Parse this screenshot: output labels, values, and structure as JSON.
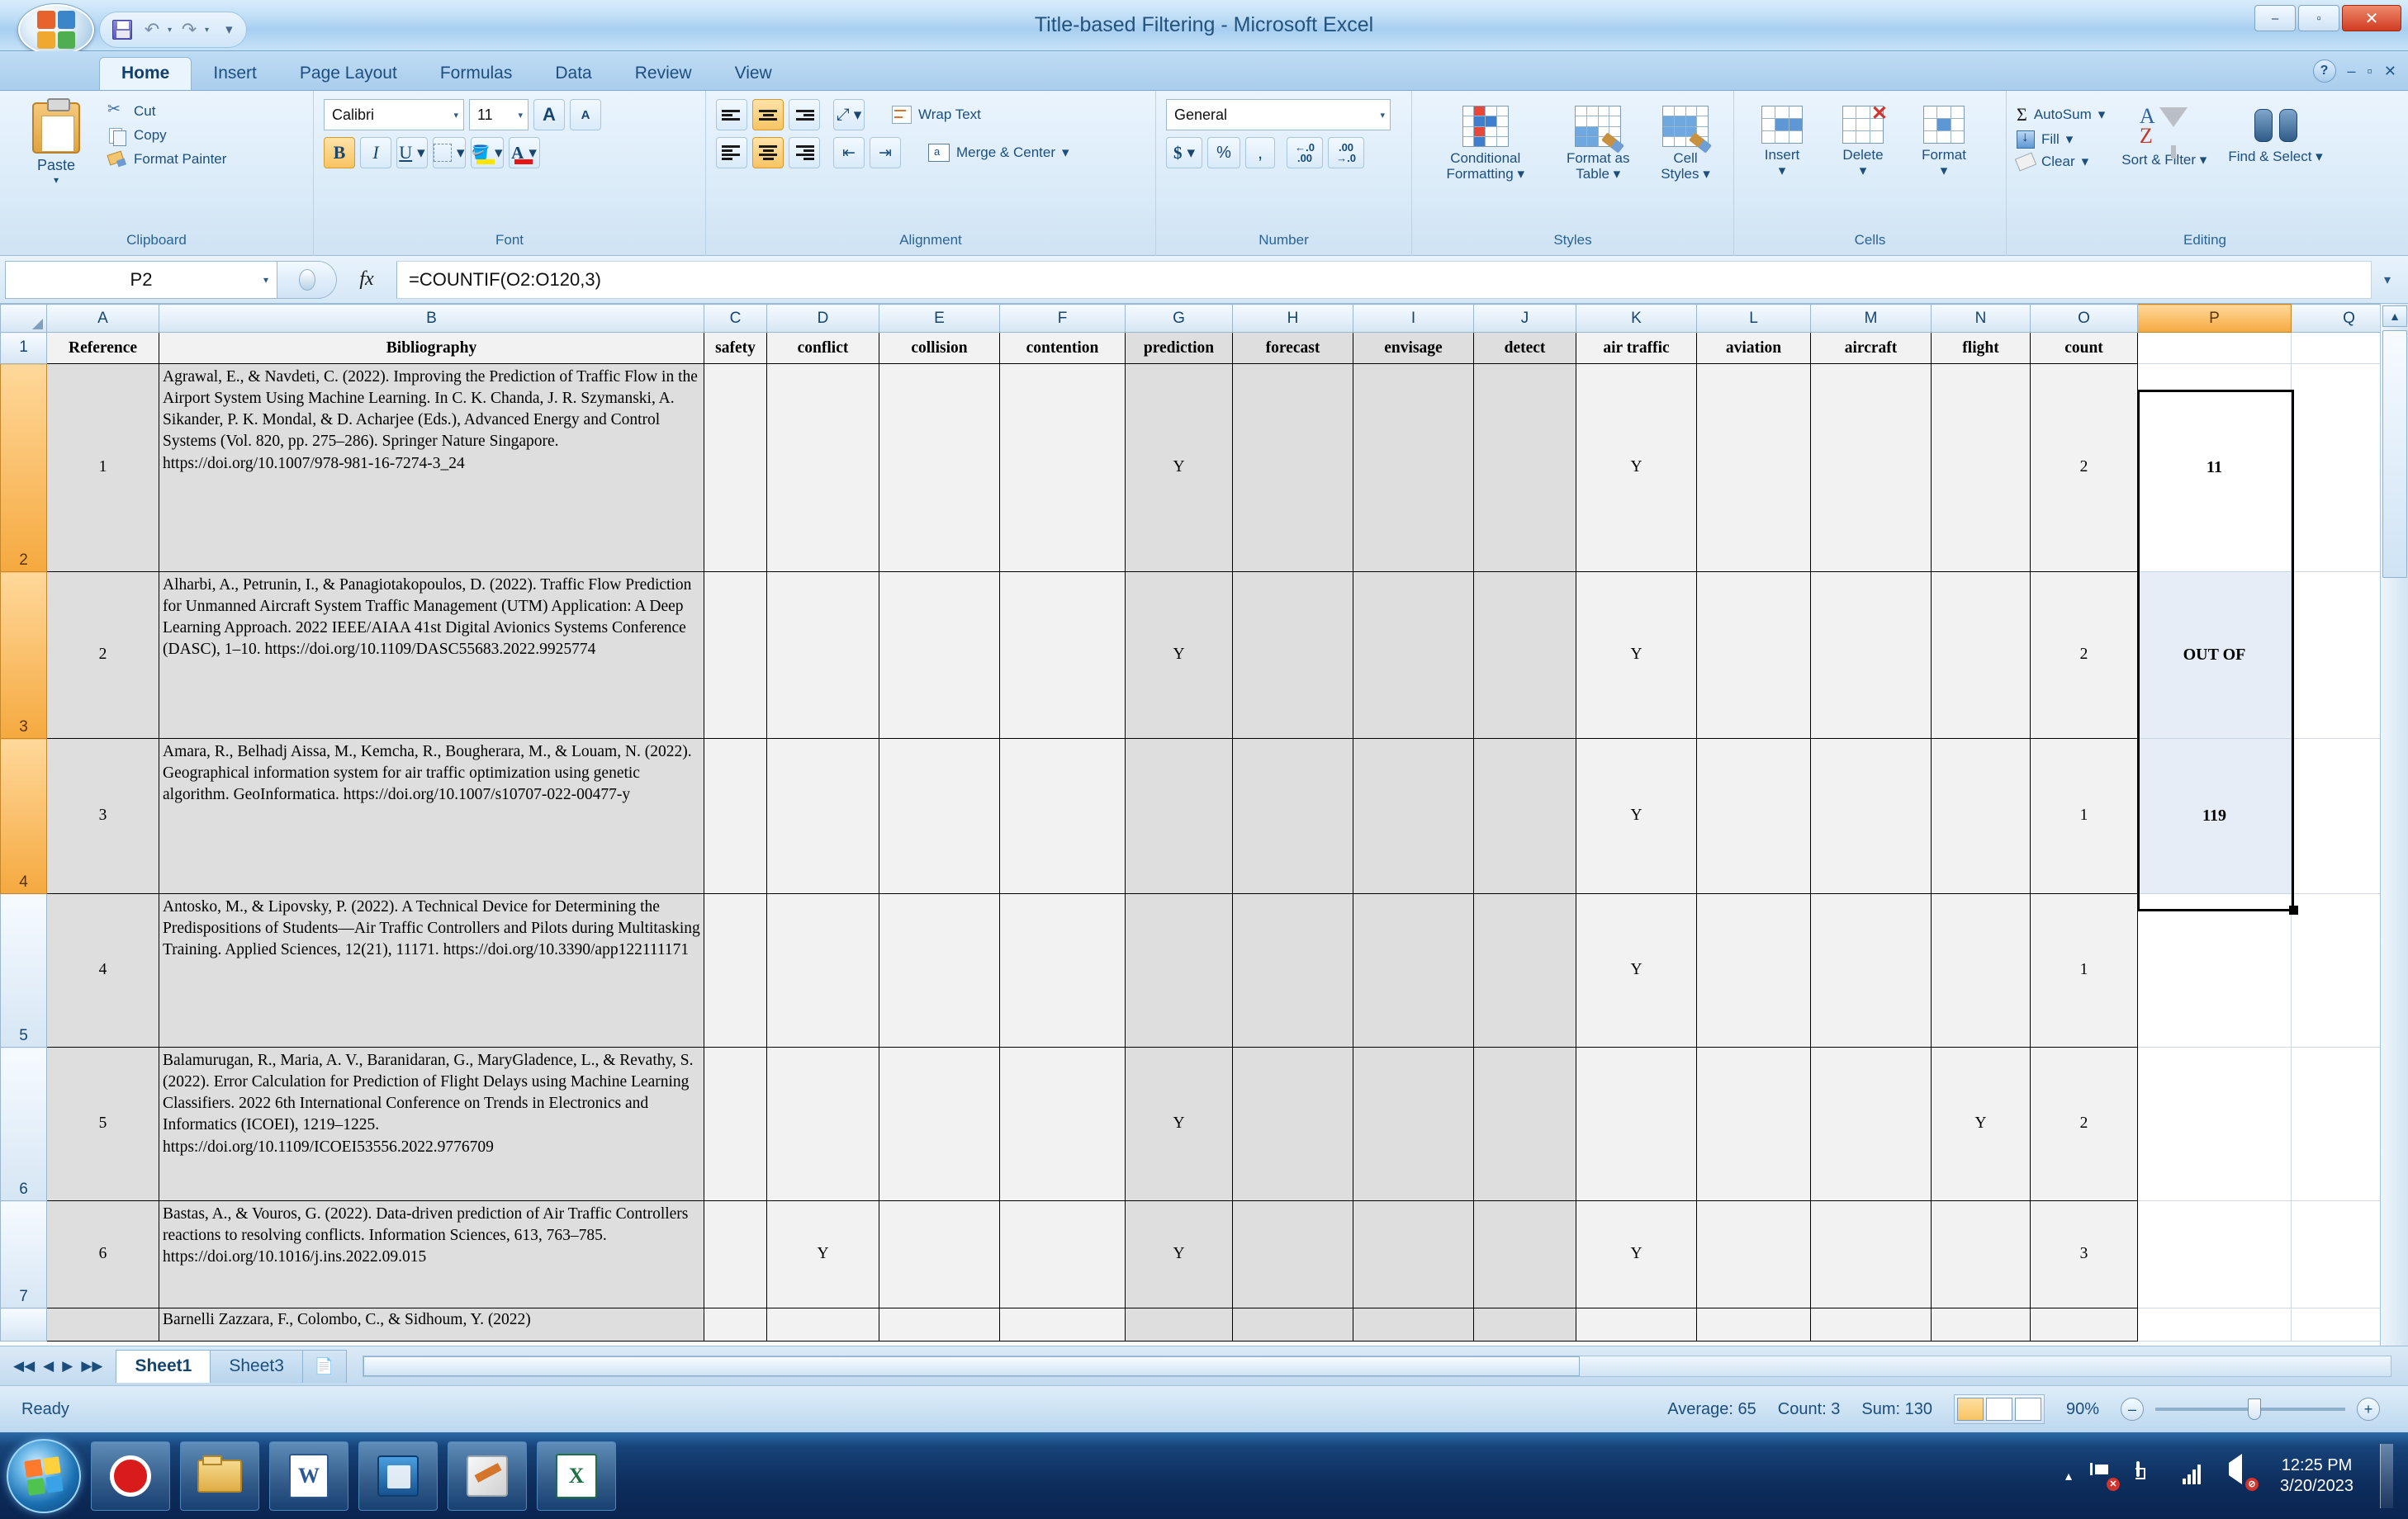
{
  "window": {
    "title": "Title-based Filtering - Microsoft Excel",
    "minimize": "–",
    "maximize": "▫",
    "close": "✕"
  },
  "quick_access": {
    "save": "save-icon",
    "undo": "↶",
    "redo": "↷",
    "undo_caret": "▾",
    "redo_caret": "▾",
    "customize": "▾"
  },
  "ribbon": {
    "tabs": [
      {
        "label": "Home",
        "active": true
      },
      {
        "label": "Insert",
        "active": false
      },
      {
        "label": "Page Layout",
        "active": false
      },
      {
        "label": "Formulas",
        "active": false
      },
      {
        "label": "Data",
        "active": false
      },
      {
        "label": "Review",
        "active": false
      },
      {
        "label": "View",
        "active": false
      }
    ],
    "help": "?",
    "minimize_ribbon": "–",
    "restore_window": "▫",
    "close_window": "✕",
    "groups": {
      "clipboard": {
        "label": "Clipboard",
        "paste": "Paste",
        "paste_caret": "▾",
        "cut": "Cut",
        "copy": "Copy",
        "format_painter": "Format Painter"
      },
      "font": {
        "label": "Font",
        "font_name": "Calibri",
        "font_size": "11",
        "grow": "A",
        "shrink": "A",
        "bold": "B",
        "italic": "I",
        "underline": "U",
        "caret": "▾"
      },
      "alignment": {
        "label": "Alignment",
        "wrap_text": "Wrap Text",
        "merge_center": "Merge & Center",
        "merge_caret": "▾",
        "orientation_caret": "▾"
      },
      "number": {
        "label": "Number",
        "format": "General",
        "currency": "$",
        "percent": "%",
        "comma": ",",
        "inc_decimal": ".00",
        "dec_decimal": ".00",
        "caret": "▾"
      },
      "styles": {
        "label": "Styles",
        "conditional_formatting": "Conditional Formatting",
        "format_as_table": "Format as Table",
        "cell_styles": "Cell Styles",
        "caret": "▾"
      },
      "cells": {
        "label": "Cells",
        "insert": "Insert",
        "delete": "Delete",
        "format": "Format",
        "caret": "▾"
      },
      "editing": {
        "label": "Editing",
        "autosum": "AutoSum",
        "fill": "Fill",
        "clear": "Clear",
        "sort_filter": "Sort & Filter",
        "find_select": "Find & Select",
        "caret": "▾",
        "sigma": "Σ"
      }
    }
  },
  "formula_bar": {
    "name_box": "P2",
    "name_caret": "▾",
    "fx": "fx",
    "formula": "=COUNTIF(O2:O120,3)",
    "expand": "▾"
  },
  "sheet": {
    "column_letters": [
      "A",
      "B",
      "C",
      "D",
      "E",
      "F",
      "G",
      "H",
      "I",
      "J",
      "K",
      "L",
      "M",
      "N",
      "O",
      "P",
      "Q"
    ],
    "selected_column": "P",
    "row_numbers": [
      "1",
      "2",
      "3",
      "4",
      "5",
      "6",
      "7"
    ],
    "selected_rows": [
      "2",
      "3",
      "4"
    ],
    "headers": [
      "Reference",
      "Bibliography",
      "safety",
      "conflict",
      "collision",
      "contention",
      "prediction",
      "forecast",
      "envisage",
      "detect",
      "air traffic",
      "aviation",
      "aircraft",
      "flight",
      "count"
    ],
    "rows": [
      {
        "reference": "1",
        "bibliography": "Agrawal, E., & Navdeti, C. (2022). Improving the Prediction of Traffic Flow in the Airport System Using Machine Learning. In C. K. Chanda, J. R. Szymanski, A. Sikander, P. K. Mondal, & D. Acharjee (Eds.), Advanced Energy and Control Systems (Vol. 820, pp. 275–286). Springer Nature Singapore. https://doi.org/10.1007/978-981-16-7274-3_24",
        "safety": "",
        "conflict": "",
        "collision": "",
        "contention": "",
        "prediction": "Y",
        "forecast": "",
        "envisage": "",
        "detect": "",
        "air_traffic": "Y",
        "aviation": "",
        "aircraft": "",
        "flight": "",
        "count": "2"
      },
      {
        "reference": "2",
        "bibliography": "Alharbi, A., Petrunin, I., & Panagiotakopoulos, D. (2022). Traffic Flow Prediction for Unmanned Aircraft System Traffic Management (UTM) Application: A Deep Learning Approach. 2022 IEEE/AIAA 41st Digital Avionics Systems Conference (DASC), 1–10. https://doi.org/10.1109/DASC55683.2022.9925774",
        "safety": "",
        "conflict": "",
        "collision": "",
        "contention": "",
        "prediction": "Y",
        "forecast": "",
        "envisage": "",
        "detect": "",
        "air_traffic": "Y",
        "aviation": "",
        "aircraft": "",
        "flight": "",
        "count": "2"
      },
      {
        "reference": "3",
        "bibliography": "Amara, R., Belhadj Aissa, M., Kemcha, R., Bougherara, M., & Louam, N. (2022). Geographical information system for air traffic optimization using genetic algorithm. GeoInformatica. https://doi.org/10.1007/s10707-022-00477-y",
        "safety": "",
        "conflict": "",
        "collision": "",
        "contention": "",
        "prediction": "",
        "forecast": "",
        "envisage": "",
        "detect": "",
        "air_traffic": "Y",
        "aviation": "",
        "aircraft": "",
        "flight": "",
        "count": "1"
      },
      {
        "reference": "4",
        "bibliography": "Antosko, M., & Lipovsky, P. (2022). A Technical Device for Determining the Predispositions of Students—Air Traffic Controllers and Pilots during Multitasking Training. Applied Sciences, 12(21), 11171. https://doi.org/10.3390/app122111171",
        "safety": "",
        "conflict": "",
        "collision": "",
        "contention": "",
        "prediction": "",
        "forecast": "",
        "envisage": "",
        "detect": "",
        "air_traffic": "Y",
        "aviation": "",
        "aircraft": "",
        "flight": "",
        "count": "1"
      },
      {
        "reference": "5",
        "bibliography": "Balamurugan, R., Maria, A. V., Baranidaran, G., MaryGladence, L., & Revathy, S. (2022). Error Calculation for Prediction of Flight Delays using Machine Learning Classifiers. 2022 6th International Conference on Trends in Electronics and Informatics (ICOEI), 1219–1225. https://doi.org/10.1109/ICOEI53556.2022.9776709",
        "safety": "",
        "conflict": "",
        "collision": "",
        "contention": "",
        "prediction": "Y",
        "forecast": "",
        "envisage": "",
        "detect": "",
        "air_traffic": "",
        "aviation": "",
        "aircraft": "",
        "flight": "Y",
        "count": "2"
      },
      {
        "reference": "6",
        "bibliography": "Bastas, A., & Vouros, G. (2022). Data-driven prediction of Air Traffic Controllers reactions to resolving conflicts. Information Sciences, 613, 763–785. https://doi.org/10.1016/j.ins.2022.09.015",
        "safety": "",
        "conflict": "Y",
        "collision": "",
        "contention": "",
        "prediction": "Y",
        "forecast": "",
        "envisage": "",
        "detect": "",
        "air_traffic": "Y",
        "aviation": "",
        "aircraft": "",
        "flight": "",
        "count": "3"
      },
      {
        "reference": "",
        "bibliography": "Barnelli Zazzara, F., Colombo, C., & Sidhoum, Y. (2022)",
        "safety": "",
        "conflict": "",
        "collision": "",
        "contention": "",
        "prediction": "",
        "forecast": "",
        "envisage": "",
        "detect": "",
        "air_traffic": "",
        "aviation": "",
        "aircraft": "",
        "flight": "",
        "count": ""
      }
    ],
    "p_column": [
      "11",
      "OUT OF",
      "119"
    ]
  },
  "sheet_tabs": {
    "first": "◀◀",
    "prev": "◀",
    "next": "▶",
    "last": "▶▶",
    "tabs": [
      {
        "label": "Sheet1",
        "active": true
      },
      {
        "label": "Sheet3",
        "active": false
      }
    ],
    "insert_sheet": "insert-worksheet-icon"
  },
  "status_bar": {
    "state": "Ready",
    "average": "Average: 65",
    "count": "Count: 3",
    "sum": "Sum: 130",
    "view_normal": "normal-view-icon",
    "view_layout": "page-layout-view-icon",
    "view_break": "page-break-view-icon",
    "zoom": "90%",
    "zoom_out": "–",
    "zoom_in": "+"
  },
  "taskbar": {
    "start": "start-orb",
    "items": [
      {
        "name": "opera-browser"
      },
      {
        "name": "windows-explorer"
      },
      {
        "name": "microsoft-word"
      },
      {
        "name": "media-app"
      },
      {
        "name": "microsoft-paint"
      },
      {
        "name": "microsoft-excel"
      }
    ],
    "tray": {
      "show_hidden": "▴",
      "network_flag": "action-center",
      "battery": "battery-icon",
      "signal": "signal-icon",
      "volume": "volume-muted-icon"
    },
    "time": "12:25 PM",
    "date": "3/20/2023"
  },
  "colors": {
    "accent_orange": "#f5a93f",
    "ribbon_blue": "#1d4f7d",
    "selection_black": "#000000"
  }
}
